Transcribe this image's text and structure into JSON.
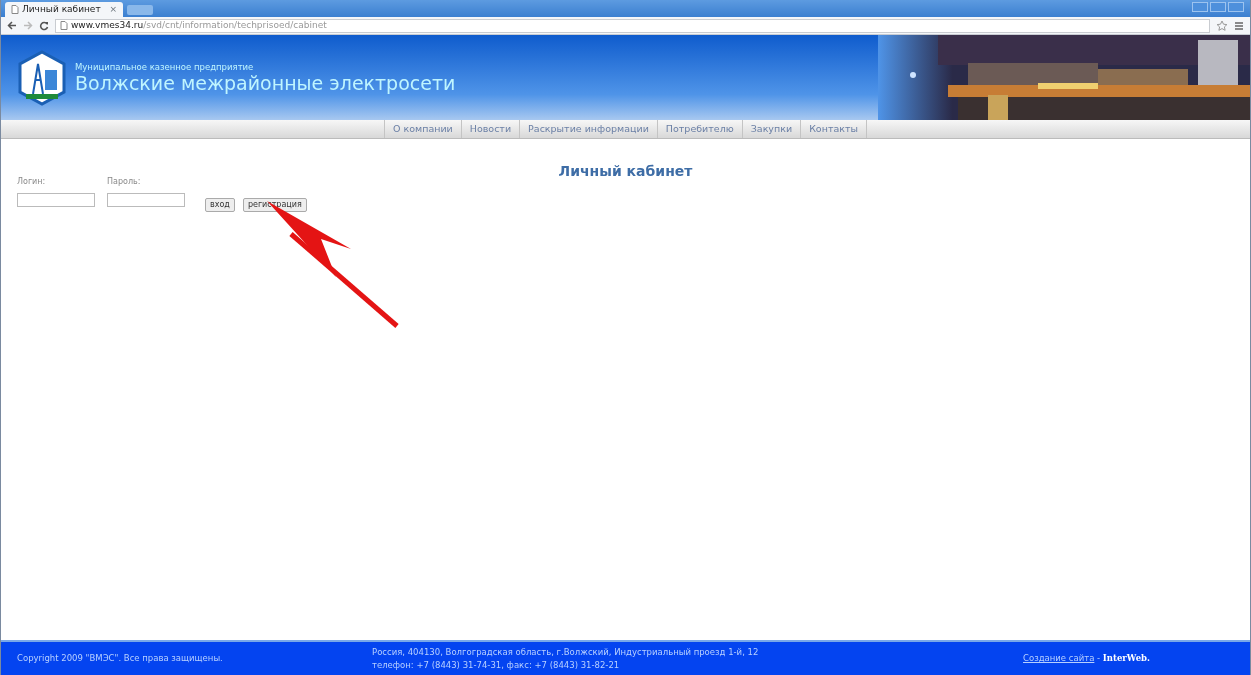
{
  "browser": {
    "tab_title": "Личный кабинет",
    "tab_close": "×",
    "url_host": "www.vmes34.ru",
    "url_path": "/svd/cnt/information/techprisoed/cabinet"
  },
  "header": {
    "subtitle": "Муниципальное казенное предприятие",
    "title": "Волжские межрайонные электросети"
  },
  "nav": [
    "О компании",
    "Новости",
    "Раскрытие информации",
    "Потребителю",
    "Закупки",
    "Контакты"
  ],
  "page_title": "Личный кабинет",
  "login_form": {
    "fields": [
      {
        "label": "Логин:"
      },
      {
        "label": "Пароль:"
      }
    ],
    "buttons": [
      "вход",
      "регистрация"
    ]
  },
  "footer": {
    "copyright": "Copyright 2009 \"ВМЭС\". Все права защищены.",
    "address": "Россия, 404130, Волгоградская область, г.Волжский, Индустриальный проезд 1-й, 12",
    "phones": "телефон: +7 (8443) 31-74-31, факс: +7 (8443) 31-82-21",
    "credit_link": "Создание сайта",
    "credit_sep": "-",
    "credit_brand": "InterWeb."
  }
}
